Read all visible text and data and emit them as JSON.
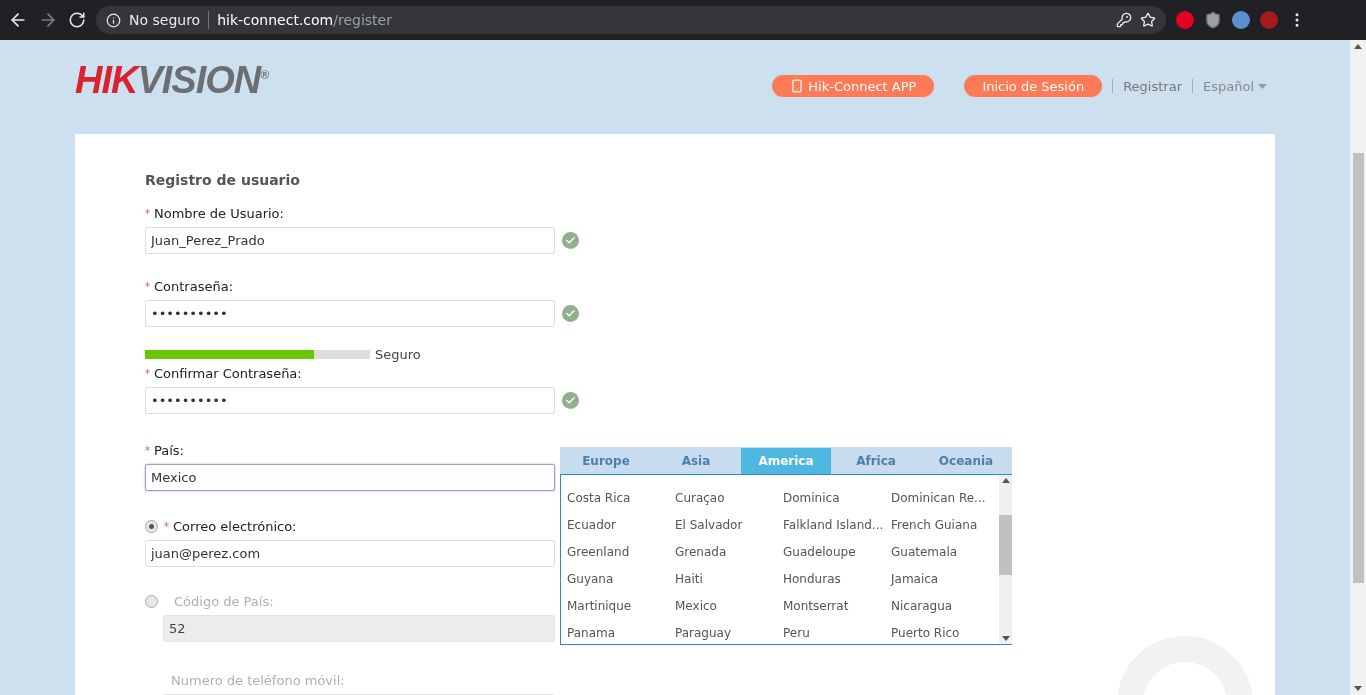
{
  "browser": {
    "security": "No seguro",
    "url_host": "hik-connect.com",
    "url_path": "/register"
  },
  "logo": {
    "red": "HIK",
    "grey": "VISION",
    "mark": "®"
  },
  "nav": {
    "app_button": "Hik-Connect APP",
    "login_button": "Inicio de Sesión",
    "register_link": "Registrar",
    "language": "Español"
  },
  "form": {
    "title": "Registro de usuario",
    "username": {
      "required": "*",
      "label": "Nombre de Usuario:",
      "value": "Juan_Perez_Prado",
      "valid": true
    },
    "password": {
      "required": "*",
      "label": "Contraseña:",
      "value": "••••••••••",
      "valid": true
    },
    "strength": {
      "level": 0.75,
      "reading": "Seguro"
    },
    "confirm": {
      "required": "*",
      "label": "Confirmar Contraseña:",
      "value": "••••••••••",
      "valid": true
    },
    "country": {
      "required": "*",
      "label": "País:",
      "value": "Mexico",
      "focused": true
    },
    "email": {
      "selected": true,
      "required": "*",
      "label": "Correo electrónico:",
      "value": "juan@perez.com"
    },
    "phone_code": {
      "selected": false,
      "label": "Código de País:",
      "value": "52",
      "disabled": true
    },
    "phone": {
      "label": "Numero de teléfono móvil:",
      "disabled": true
    }
  },
  "country_picker": {
    "tabs": [
      {
        "label": "Europe",
        "selected": false
      },
      {
        "label": "Asia",
        "selected": false
      },
      {
        "label": "America",
        "selected": true
      },
      {
        "label": "Africa",
        "selected": false
      },
      {
        "label": "Oceania",
        "selected": false
      }
    ],
    "countries": [
      "Costa Rica",
      "Curaçao",
      "Dominica",
      "Dominican Re...",
      "Ecuador",
      "El Salvador",
      "Falkland Island...",
      "French Guiana",
      "Greenland",
      "Grenada",
      "Guadeloupe",
      "Guatemala",
      "Guyana",
      "Haiti",
      "Honduras",
      "Jamaica",
      "Martinique",
      "Mexico",
      "Montserrat",
      "Nicaragua",
      "Panama",
      "Paraguay",
      "Peru",
      "Puerto Rico"
    ]
  }
}
